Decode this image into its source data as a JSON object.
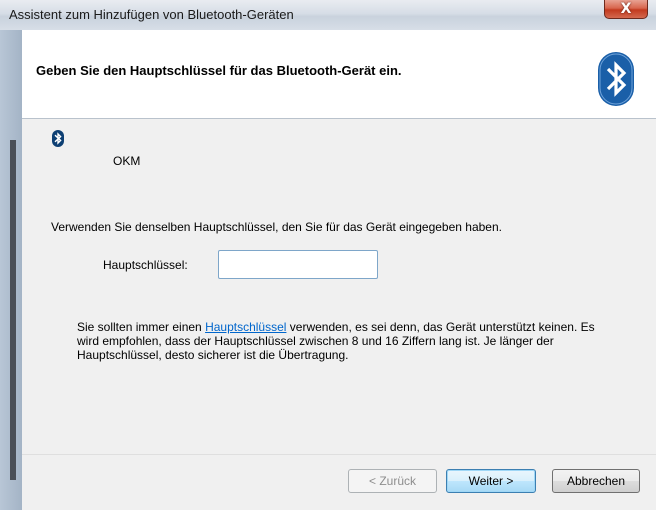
{
  "window": {
    "title": "Assistent zum Hinzufügen von Bluetooth-Geräten",
    "close_label": "X"
  },
  "header": {
    "title": "Geben Sie den Hauptschlüssel für das Bluetooth-Gerät ein.",
    "logo_icon": "bluetooth-icon"
  },
  "device": {
    "icon": "bluetooth-icon",
    "name": "OKM"
  },
  "instruction": "Verwenden Sie denselben Hauptschlüssel, den Sie für das Gerät eingegeben haben.",
  "passkey": {
    "label": "Hauptschlüssel:",
    "value": "",
    "placeholder": ""
  },
  "info": {
    "text_before": "Sie sollten immer einen ",
    "link": "Hauptschlüssel",
    "text_after": " verwenden, es sei denn, das Gerät unterstützt keinen. Es wird empfohlen, dass der Hauptschlüssel zwischen 8 und 16 Ziffern lang ist. Je länger der Hauptschlüssel, desto sicherer ist die Übertragung."
  },
  "buttons": {
    "back": "< Zurück",
    "next": "Weiter >",
    "cancel": "Abbrechen"
  },
  "colors": {
    "bluetooth_blue": "#1a5fa8",
    "link": "#0066cc",
    "close_red": "#c23a1f"
  }
}
